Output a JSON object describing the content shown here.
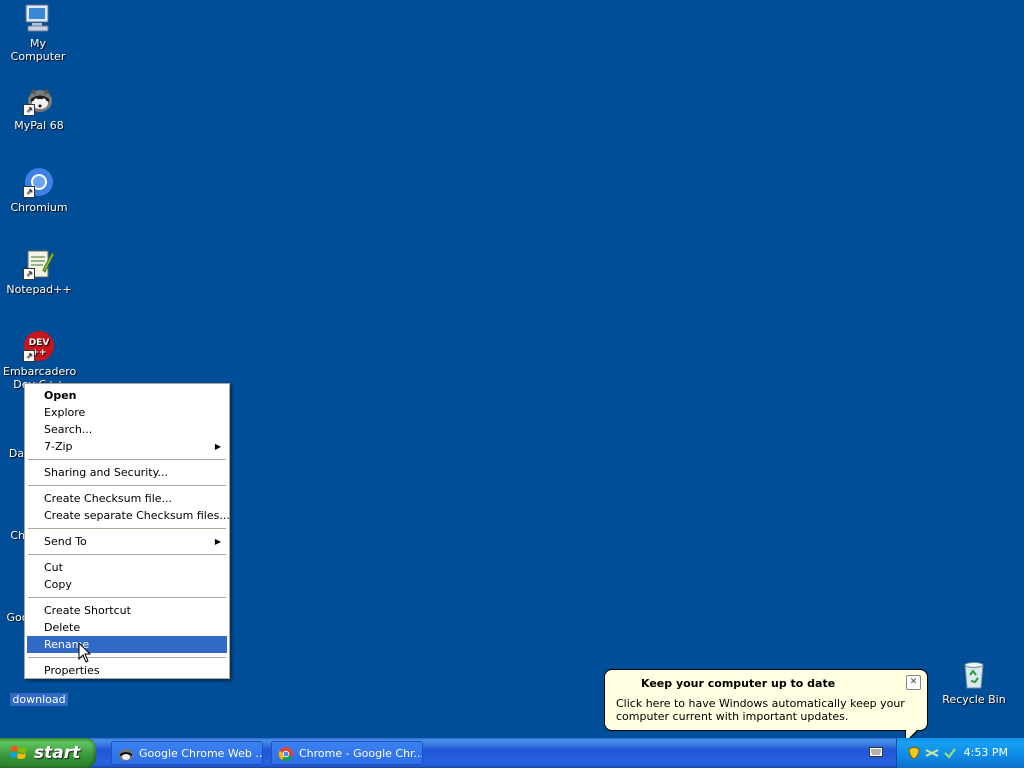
{
  "desktop": {
    "icons": [
      {
        "label": "My Computer",
        "icon": "my-computer-icon"
      },
      {
        "label": "MyPal 68",
        "icon": "mypal-icon"
      },
      {
        "label": "Chromium",
        "icon": "chromium-icon"
      },
      {
        "label": "Notepad++",
        "icon": "notepadpp-icon"
      },
      {
        "label": "Embarcadero",
        "label2": "Dev-C++",
        "icon": "devcpp-icon"
      },
      {
        "label": "Data",
        "icon": "shortcut-icon"
      },
      {
        "label": "Chr",
        "icon": "shortcut-icon"
      },
      {
        "label": "Goog",
        "icon": "shortcut-icon"
      },
      {
        "label": "download",
        "icon": "folder-icon"
      },
      {
        "label": "Recycle Bin",
        "icon": "recycle-bin-icon"
      }
    ]
  },
  "context_menu": {
    "items": [
      {
        "label": "Open"
      },
      {
        "label": "Explore"
      },
      {
        "label": "Search..."
      },
      {
        "label": "7-Zip"
      },
      {
        "label": "Sharing and Security..."
      },
      {
        "label": "Create Checksum file..."
      },
      {
        "label": "Create separate Checksum files..."
      },
      {
        "label": "Send To"
      },
      {
        "label": "Cut"
      },
      {
        "label": "Copy"
      },
      {
        "label": "Create Shortcut"
      },
      {
        "label": "Delete"
      },
      {
        "label": "Rename"
      },
      {
        "label": "Properties"
      }
    ]
  },
  "taskbar": {
    "start_label": "start",
    "tasks": [
      {
        "label": "Google Chrome Web ...",
        "icon": "mypal-icon"
      },
      {
        "label": "Chrome - Google Chr...",
        "icon": "chrome-icon"
      }
    ],
    "clock": "4:53 PM"
  },
  "balloon": {
    "title": "Keep your computer up to date",
    "body": "Click here to have Windows automatically keep your computer current with important updates.",
    "close_glyph": "✕"
  },
  "colors": {
    "desktop": "#004E98",
    "selection": "#316AC5",
    "balloon": "#FFFFE1"
  }
}
